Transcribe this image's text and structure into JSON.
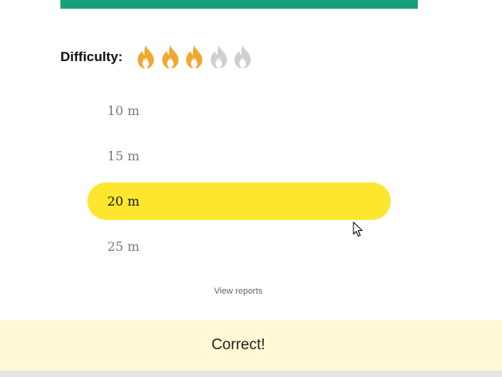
{
  "difficulty": {
    "label": "Difficulty:",
    "level": 3,
    "max": 5,
    "active_color": "#f0a830",
    "inactive_color": "#cfcfcf"
  },
  "options": [
    {
      "label": "10 m",
      "selected": false
    },
    {
      "label": "15 m",
      "selected": false
    },
    {
      "label": "20 m",
      "selected": true
    },
    {
      "label": "25 m",
      "selected": false
    }
  ],
  "view_reports": "View reports",
  "feedback": {
    "text": "Correct!"
  },
  "colors": {
    "accent_bar": "#1a9e7a",
    "selected_option": "#fde72e",
    "feedback_bg": "#fef8d4"
  }
}
